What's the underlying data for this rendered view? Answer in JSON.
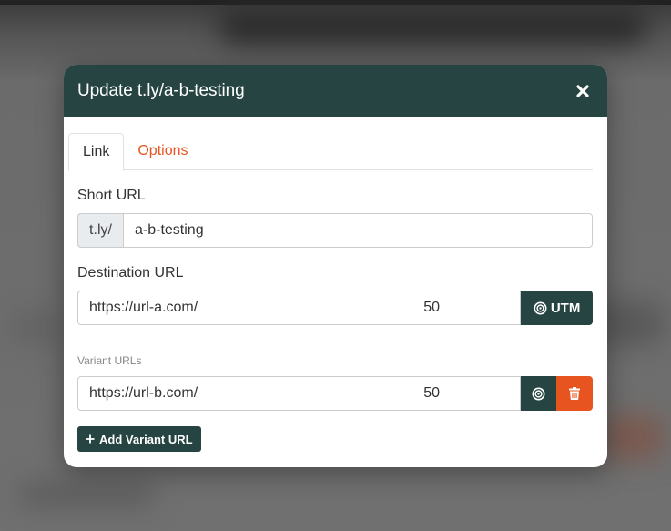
{
  "modal": {
    "title": "Update t.ly/a-b-testing",
    "tabs": [
      {
        "label": "Link"
      },
      {
        "label": "Options"
      }
    ],
    "short_url": {
      "label": "Short URL",
      "prefix": "t.ly/",
      "value": "a-b-testing"
    },
    "destination": {
      "label": "Destination URL",
      "url": "https://url-a.com/",
      "weight": "50",
      "utm_label": "UTM"
    },
    "variants": {
      "label": "Variant URLs",
      "items": [
        {
          "url": "https://url-b.com/",
          "weight": "50"
        }
      ],
      "add_label": "Add Variant URL"
    }
  },
  "colors": {
    "header": "#264542",
    "accent": "#e8541f"
  },
  "icons": {
    "close": "close-icon",
    "target": "target-icon",
    "trash": "trash-icon",
    "plus": "plus-icon"
  }
}
